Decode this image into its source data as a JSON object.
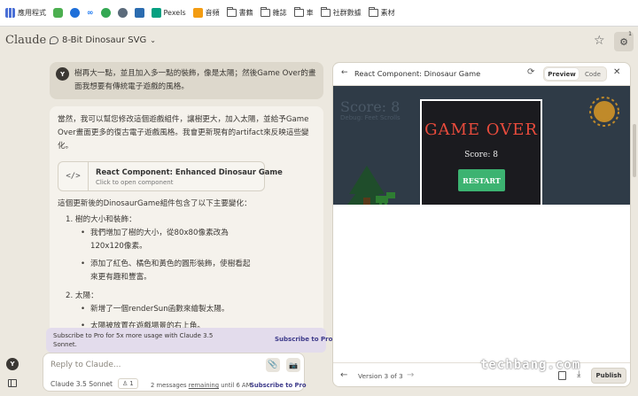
{
  "bookmarks": [
    {
      "label": "應用程式",
      "icon": "apps-grid-icon",
      "color": "#4a6fd6"
    },
    {
      "label": "",
      "icon": "puzzle-icon",
      "color": "#4caf50"
    },
    {
      "label": "",
      "icon": "c-logo-icon",
      "color": "#1e6fd9"
    },
    {
      "label": "",
      "icon": "meta-icon",
      "color": "#1877f2"
    },
    {
      "label": "",
      "icon": "chart-icon",
      "color": "#34a853"
    },
    {
      "label": "",
      "icon": "globe-icon",
      "color": "#5b6b7b"
    },
    {
      "label": "",
      "icon": "square-icon",
      "color": "#2b6cb0"
    },
    {
      "label": "Pexels",
      "icon": "pexels-icon",
      "color": "#05a081"
    },
    {
      "label": "音頻",
      "icon": "audio-icon",
      "color": "#f39c12"
    },
    {
      "label": "書籍",
      "icon": "folder-icon"
    },
    {
      "label": "雜誌",
      "icon": "folder-icon"
    },
    {
      "label": "車",
      "icon": "folder-icon"
    },
    {
      "label": "社群數據",
      "icon": "folder-icon"
    },
    {
      "label": "素材",
      "icon": "folder-icon"
    }
  ],
  "header": {
    "brand": "Claude",
    "chat_title": "8-Bit Dinosaur SVG",
    "tune_badge": "1"
  },
  "user_message": {
    "avatar": "Y",
    "text": "樹再大一點，並且加入多一點的裝飾，像是太陽；然後Game Over的畫面我想要有傳統電子遊戲的風格。"
  },
  "reply": {
    "intro": "當然，我可以幫您修改這個遊戲組件，讓樹更大，加入太陽，並給予Game Over畫面更多的復古電子遊戲風格。我會更新現有的artifact來反映這些變化。",
    "artifact_title": "React Component: Enhanced Dinosaur Game",
    "artifact_subtitle": "Click to open component",
    "summary": "這個更新後的DinosaurGame組件包含了以下主要變化：",
    "item1": "1. 樹的大小和裝飾：",
    "item1_b1_l1": "我們增加了樹的大小，從80x80像素改為",
    "item1_b1_l2": "120x120像素。",
    "item1_b2_l1": "添加了紅色、橘色和黃色的圓形裝飾，使樹看起",
    "item1_b2_l2": "來更有趣和豐富。",
    "item2": "2. 太陽：",
    "item2_b1": "新增了一個renderSun函數來繪製太陽。",
    "item2_b2": "太陽被放置在遊戲場景的右上角。"
  },
  "upsell": {
    "text": "Subscribe to Pro for 5x more usage with Claude 3.5 Sonnet.",
    "link": "Subscribe to Pro"
  },
  "composer": {
    "placeholder": "Reply to Claude...",
    "model": "Claude 3.5 Sonnet",
    "people_count": "1",
    "messages_prefix": "2 messages ",
    "messages_remaining": "remaining",
    "messages_suffix": " until 6 AM",
    "subscribe_link": "Subscribe to Pro"
  },
  "sidebar": {
    "avatar": "Y"
  },
  "artifact_panel": {
    "title": "React Component: Dinosaur Game",
    "tab_preview": "Preview",
    "tab_code": "Code",
    "game": {
      "background_score": "Score: 8",
      "background_sub": "Debug: Feet Scrolls",
      "game_over_title": "GAME OVER",
      "score_label": "Score: 8",
      "restart_label": "RESTART",
      "sky_color": "#2f3b47",
      "title_color": "#e84b3c",
      "button_color": "#3cb371",
      "sun_color": "#c08a2a",
      "tree_color": "#1f4d2b"
    },
    "version_label": "Version 3 of 3",
    "publish_label": "Publish"
  },
  "watermark": {
    "site": "techbang.com"
  }
}
